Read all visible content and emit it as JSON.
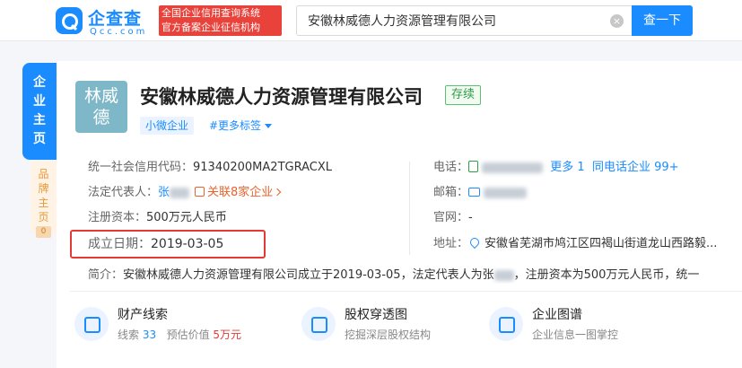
{
  "header": {
    "logo_cn": "企查查",
    "logo_en": "Qcc.com",
    "slogan_line1": "全国企业信用查询系统",
    "slogan_line2": "官方备案企业征信机构",
    "search_value": "安徽林威德人力资源管理有限公司",
    "search_button": "查一下",
    "clear_icon": "×"
  },
  "side_tabs": {
    "home": [
      "企",
      "业",
      "主",
      "页"
    ],
    "brand": [
      "品",
      "牌",
      "主",
      "页"
    ],
    "brand_count": "0"
  },
  "company": {
    "avatar_line1": "林威",
    "avatar_line2": "德",
    "name": "安徽林威德人力资源管理有限公司",
    "status": "存续",
    "tag_small": "小微企业",
    "tag_more": "#更多标签"
  },
  "info": {
    "credit_code_label": "统一社会信用代码：",
    "credit_code": "91340200MA2TGRACXL",
    "legal_rep_label": "法定代表人：",
    "legal_rep": "张",
    "related_companies": "关联8家企业",
    "capital_label": "注册资本：",
    "capital": "500万元人民币",
    "founded_label": "成立日期：",
    "founded": "2019-03-05",
    "phone_label": "电话：",
    "phone_more": "更多 1",
    "phone_same": "同电话企业 99+",
    "email_label": "邮箱：",
    "website_label": "官网：",
    "website": "-",
    "address_label": "地址：",
    "address": "安徽省芜湖市鸠江区四褐山街道龙山西路毅..."
  },
  "brief": {
    "label": "简介：",
    "text_part1": "安徽林威德人力资源管理有限公司成立于2019-03-05，法定代表人为张",
    "text_part2": "，注册资本为500万元人民币，统一"
  },
  "features": [
    {
      "title": "财产线索",
      "sub_label1": "线索",
      "sub_num1": "33",
      "sub_label2": "预估价值",
      "sub_num2": "5万元"
    },
    {
      "title": "股权穿透图",
      "sub": "挖掘深层股权结构"
    },
    {
      "title": "企业图谱",
      "sub": "企业信息一图掌控"
    }
  ],
  "colors": {
    "brand_blue": "#1a8cff",
    "status_green": "#2f9e44",
    "highlight_red": "#e53935",
    "relation_orange": "#e8632d"
  }
}
